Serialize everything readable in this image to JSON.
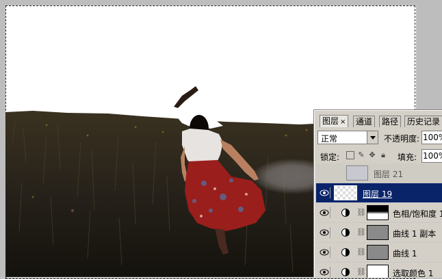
{
  "layers_panel": {
    "tabs": [
      {
        "label": "图层",
        "close": "×"
      },
      {
        "label": "通道"
      },
      {
        "label": "路径"
      },
      {
        "label": "历史记录"
      }
    ],
    "blend_mode": "正常",
    "opacity_label": "不透明度:",
    "opacity_value": "100%",
    "lock_label": "锁定:",
    "fill_label": "填充:",
    "fill_value": "100%",
    "layers": [
      {
        "name": "图层 21",
        "visible": false,
        "selected": false,
        "type": "pixel"
      },
      {
        "name": "图层 19",
        "visible": true,
        "selected": true,
        "type": "pixel"
      },
      {
        "name": "色相/饱和度 1",
        "visible": true,
        "selected": false,
        "type": "adjustment"
      },
      {
        "name": "曲线 1 副本",
        "visible": true,
        "selected": false,
        "type": "adjustment"
      },
      {
        "name": "曲线 1",
        "visible": true,
        "selected": false,
        "type": "adjustment"
      },
      {
        "name": "选取颜色 1",
        "visible": true,
        "selected": false,
        "type": "adjustment"
      }
    ]
  },
  "colors": {
    "selection_highlight": "#0a246a",
    "panel_bg": "#d4d0c8",
    "field_dark": "#2a2414",
    "dress_red": "#9a1e1c"
  }
}
